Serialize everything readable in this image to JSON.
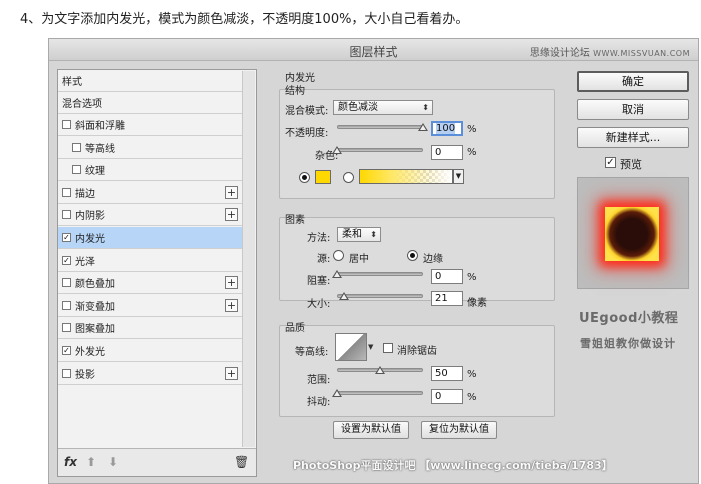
{
  "instruction": "4、为文字添加内发光，模式为颜色减淡，不透明度100%，大小自己看着办。",
  "dialog": {
    "title": "图层样式",
    "site_cn": "思缘设计论坛",
    "site_url": "WWW.MISSVUAN.COM"
  },
  "styles_list": {
    "header": "样式",
    "blend_options": "混合选项",
    "items": [
      {
        "label": "斜面和浮雕",
        "checked": false,
        "indent": false,
        "plus": false,
        "selected": false
      },
      {
        "label": "等高线",
        "checked": false,
        "indent": true,
        "plus": false,
        "selected": false
      },
      {
        "label": "纹理",
        "checked": false,
        "indent": true,
        "plus": false,
        "selected": false
      },
      {
        "label": "描边",
        "checked": false,
        "indent": false,
        "plus": true,
        "selected": false
      },
      {
        "label": "内阴影",
        "checked": false,
        "indent": false,
        "plus": true,
        "selected": false
      },
      {
        "label": "内发光",
        "checked": true,
        "indent": false,
        "plus": false,
        "selected": true
      },
      {
        "label": "光泽",
        "checked": true,
        "indent": false,
        "plus": false,
        "selected": false
      },
      {
        "label": "颜色叠加",
        "checked": false,
        "indent": false,
        "plus": true,
        "selected": false
      },
      {
        "label": "渐变叠加",
        "checked": false,
        "indent": false,
        "plus": true,
        "selected": false
      },
      {
        "label": "图案叠加",
        "checked": false,
        "indent": false,
        "plus": false,
        "selected": false
      },
      {
        "label": "外发光",
        "checked": true,
        "indent": false,
        "plus": false,
        "selected": false
      },
      {
        "label": "投影",
        "checked": false,
        "indent": false,
        "plus": true,
        "selected": false
      }
    ],
    "footer_fx": "fx",
    "footer_icons": [
      "up-arrow-icon",
      "down-arrow-icon",
      "trash-icon"
    ]
  },
  "inner_glow": {
    "title": "内发光",
    "structure": {
      "title": "结构",
      "blend_mode_label": "混合模式:",
      "blend_mode_value": "颜色减淡",
      "opacity_label": "不透明度:",
      "opacity_value": "100",
      "opacity_level": 1.0,
      "noise_label": "杂色:",
      "noise_value": "0",
      "noise_level": 0.0,
      "unit": "%",
      "color_mode": "solid",
      "color": "#ffd800"
    },
    "elements": {
      "title": "图素",
      "method_label": "方法:",
      "method_value": "柔和",
      "source_label": "源:",
      "source_center": "居中",
      "source_edge": "边缘",
      "source_selected": "edge",
      "choke_label": "阻塞:",
      "choke_value": "0",
      "choke_level": 0.0,
      "size_label": "大小:",
      "size_value": "21",
      "size_unit": "像素",
      "size_level": 0.08
    },
    "quality": {
      "title": "品质",
      "contour_label": "等高线:",
      "antialias_label": "消除锯齿",
      "antialias_checked": false,
      "range_label": "范围:",
      "range_value": "50",
      "range_level": 0.5,
      "jitter_label": "抖动:",
      "jitter_value": "0",
      "jitter_level": 0.0
    },
    "make_default": "设置为默认值",
    "reset_default": "复位为默认值"
  },
  "actions": {
    "ok": "确定",
    "cancel": "取消",
    "new_style": "新建样式...",
    "preview": "预览",
    "preview_checked": true
  },
  "branding": {
    "line1": "UEgood小教程",
    "line2": "雪姐姐教你做设计"
  },
  "watermark": "PhotoShop平面设计吧 【www.linecg.com/tieba/1783】"
}
